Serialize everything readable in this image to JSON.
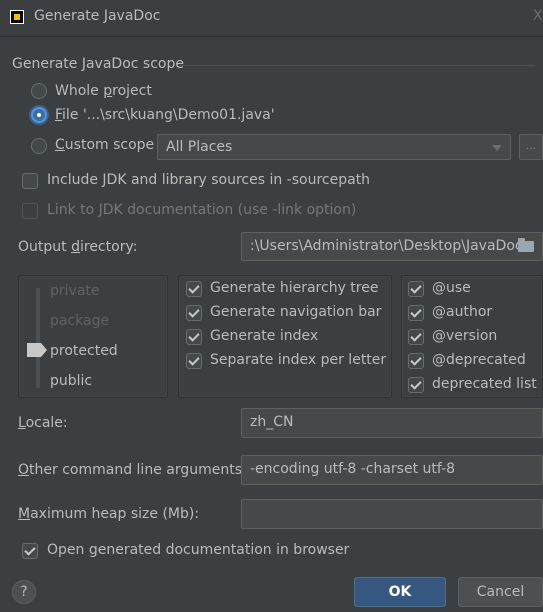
{
  "window": {
    "title": "Generate JavaDoc",
    "close_glyph": "X"
  },
  "scope": {
    "group_title": "Generate JavaDoc scope",
    "whole_project": {
      "prefix": "Whole ",
      "mnemonic": "p",
      "suffix": "roject",
      "checked": false
    },
    "file": {
      "prefix": "",
      "mnemonic": "F",
      "suffix": "ile '...\\src\\kuang\\Demo01.java'",
      "checked": true
    },
    "custom": {
      "prefix": "",
      "mnemonic": "C",
      "suffix": "ustom scope",
      "checked": false,
      "combo_value": "All Places",
      "more_button": "..."
    }
  },
  "include_jdk": {
    "label": "Include JDK and library sources in -sourcepath",
    "checked": false
  },
  "link_jdk": {
    "label": "Link to JDK documentation (use -link option)",
    "checked": false,
    "disabled": true
  },
  "output": {
    "label_prefix": "Output ",
    "mnemonic": "d",
    "label_suffix": "irectory:",
    "value": ":\\Users\\Administrator\\Desktop\\JavaDoc"
  },
  "visibility": {
    "levels": [
      "private",
      "package",
      "protected",
      "public"
    ],
    "selected": "protected"
  },
  "options": [
    {
      "label": "Generate hierarchy tree",
      "checked": true
    },
    {
      "label": "Generate navigation bar",
      "checked": true
    },
    {
      "label": "Generate index",
      "checked": true
    },
    {
      "label": "Separate index per letter",
      "checked": true
    }
  ],
  "tags": [
    {
      "label": "@use",
      "checked": true
    },
    {
      "label": "@author",
      "checked": true
    },
    {
      "label": "@version",
      "checked": true
    },
    {
      "label": "@deprecated",
      "checked": true
    },
    {
      "label": "deprecated list",
      "checked": true
    }
  ],
  "locale": {
    "mnemonic": "L",
    "suffix": "ocale:",
    "value": "zh_CN"
  },
  "other_args": {
    "mnemonic": "O",
    "suffix": "ther command line arguments:",
    "value": "-encoding utf-8 -charset utf-8"
  },
  "heap": {
    "mnemonic": "M",
    "suffix": "aximum heap size (Mb):",
    "value": ""
  },
  "open_browser": {
    "prefix": "Open ",
    "mnemonic": "g",
    "suffix": "enerated documentation in browser",
    "checked": true
  },
  "buttons": {
    "help": "?",
    "ok": "OK",
    "cancel": "Cancel"
  },
  "colors": {
    "background": "#3c3f41",
    "accent": "#365880",
    "text": "#bbbbbb"
  }
}
